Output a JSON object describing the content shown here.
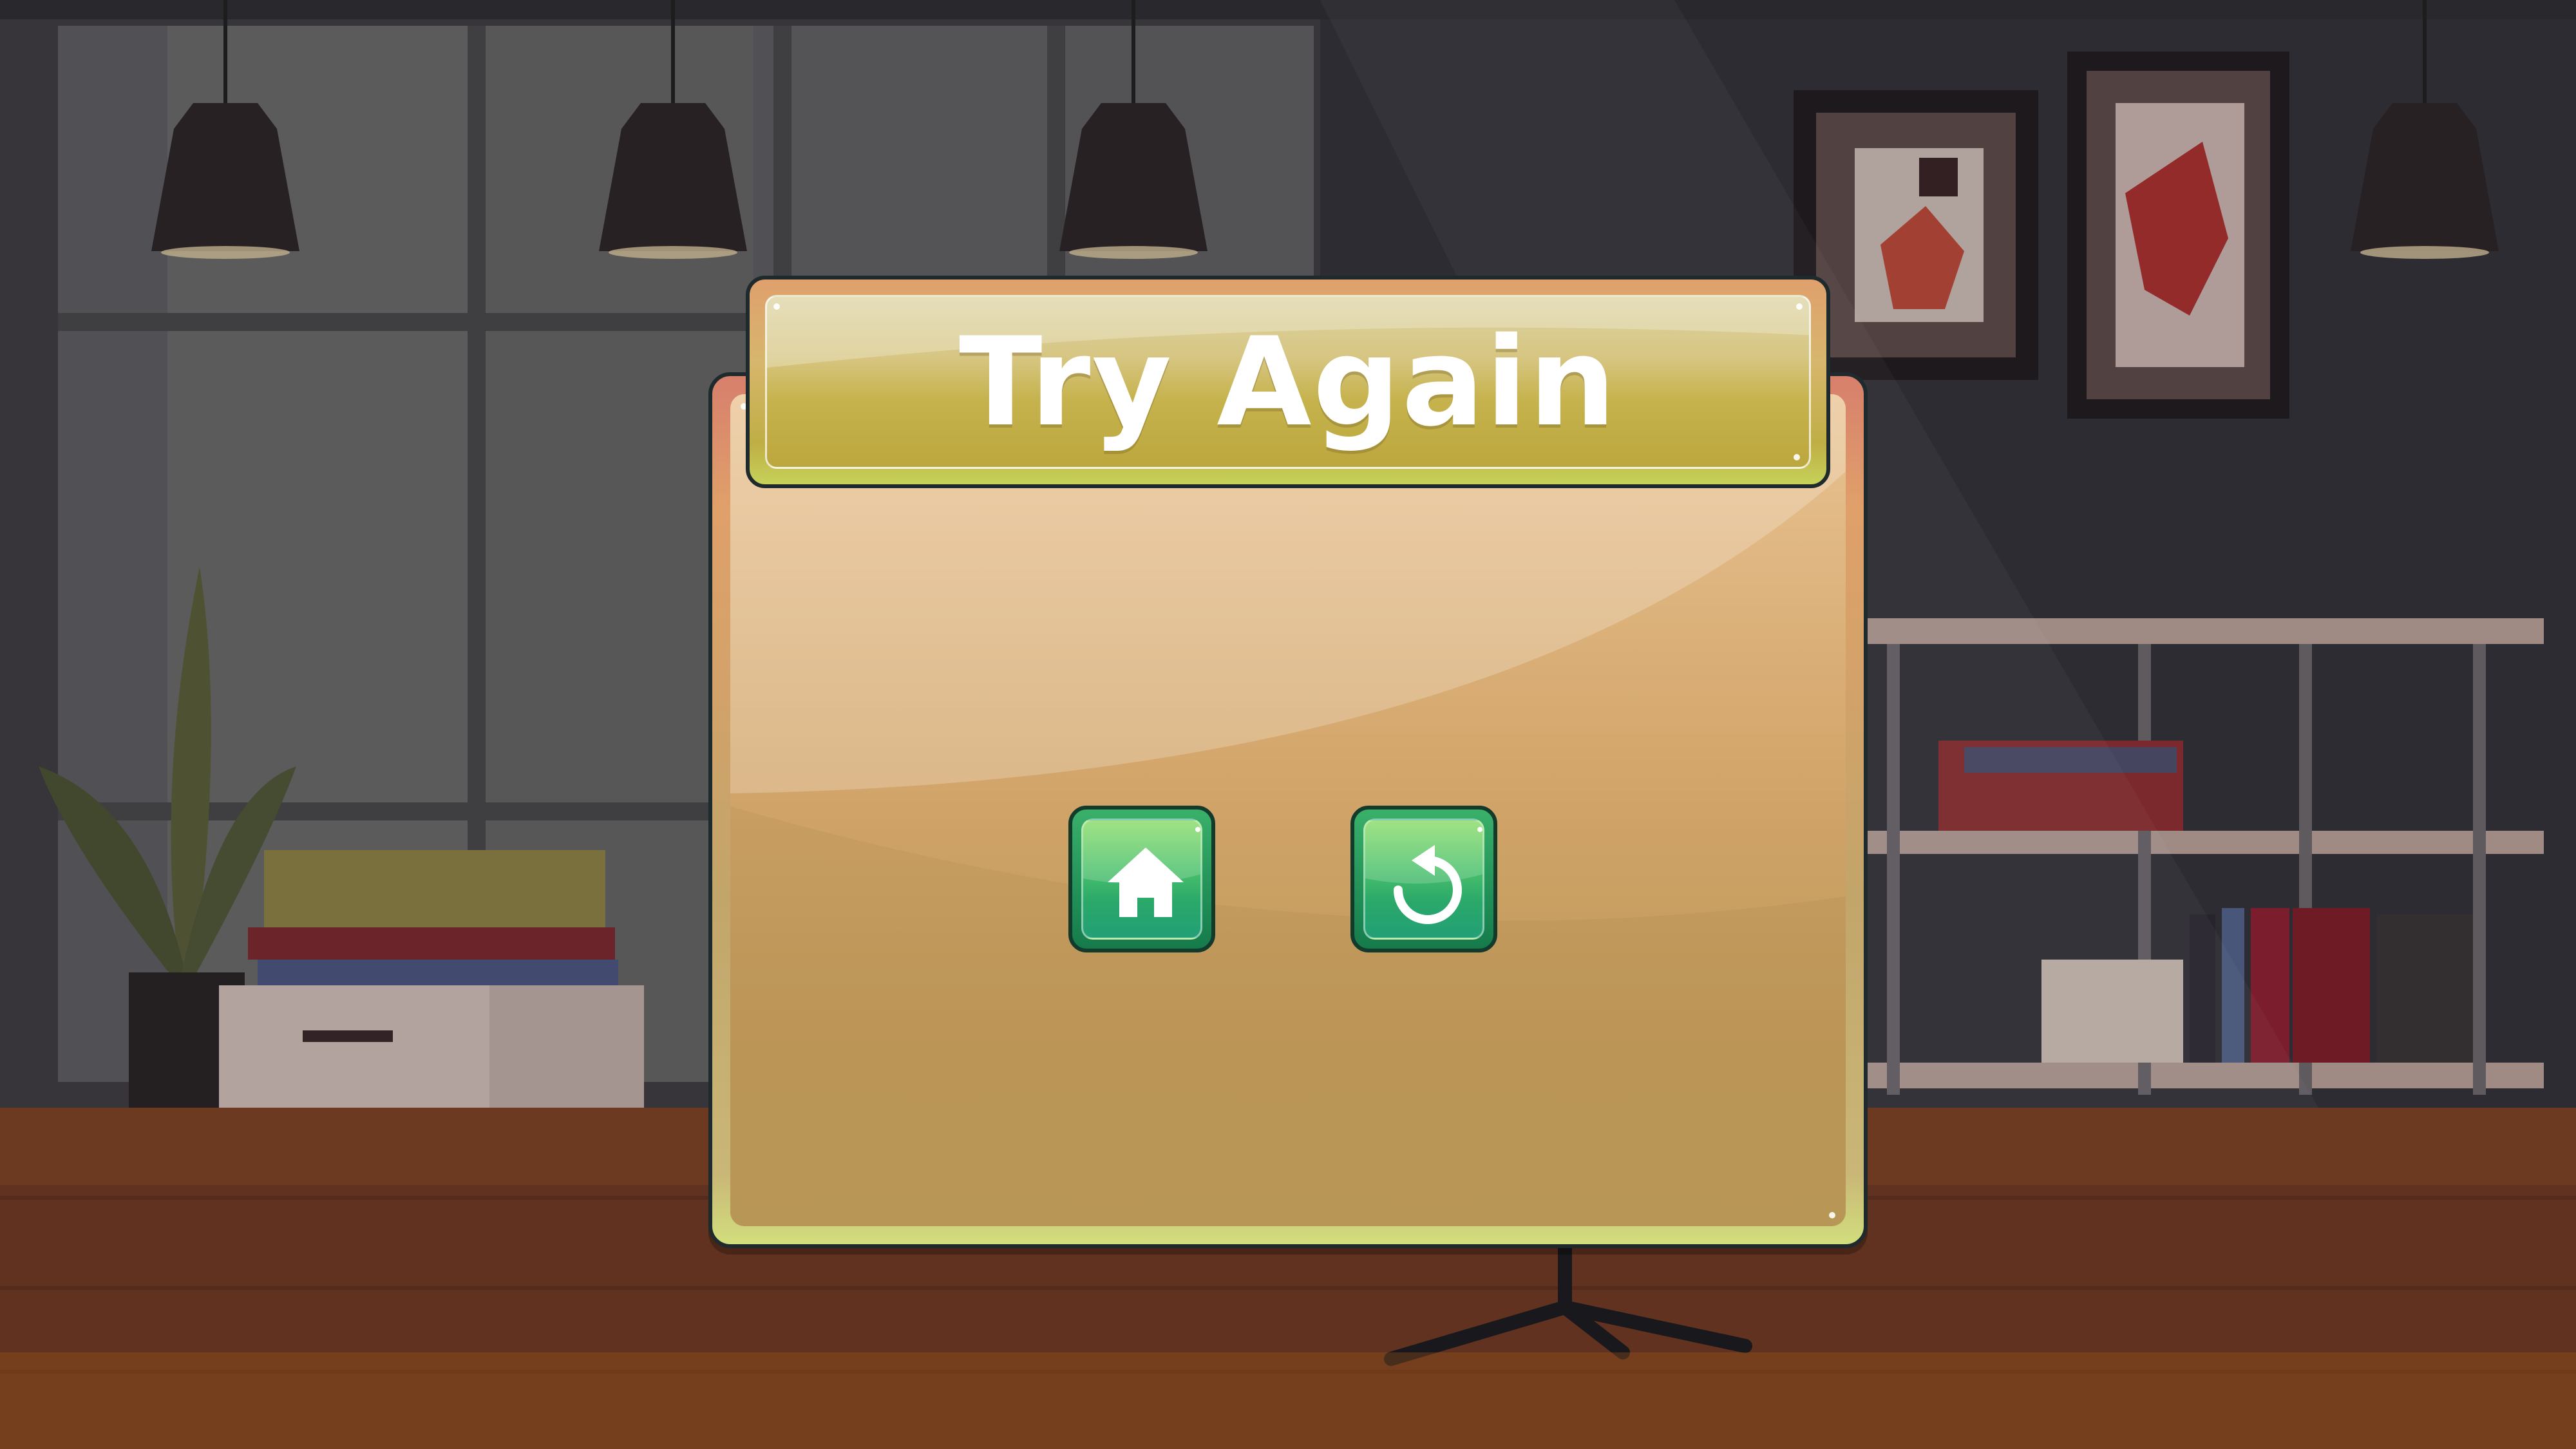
{
  "dialog": {
    "title": "Try Again"
  },
  "buttons": {
    "home_icon": "home-icon",
    "restart_icon": "restart-icon"
  },
  "colors": {
    "title_text": "#ffffff",
    "button_green": "#2aa86a",
    "panel_tan": "#d3a66b",
    "banner_gold": "#c6b34e"
  }
}
